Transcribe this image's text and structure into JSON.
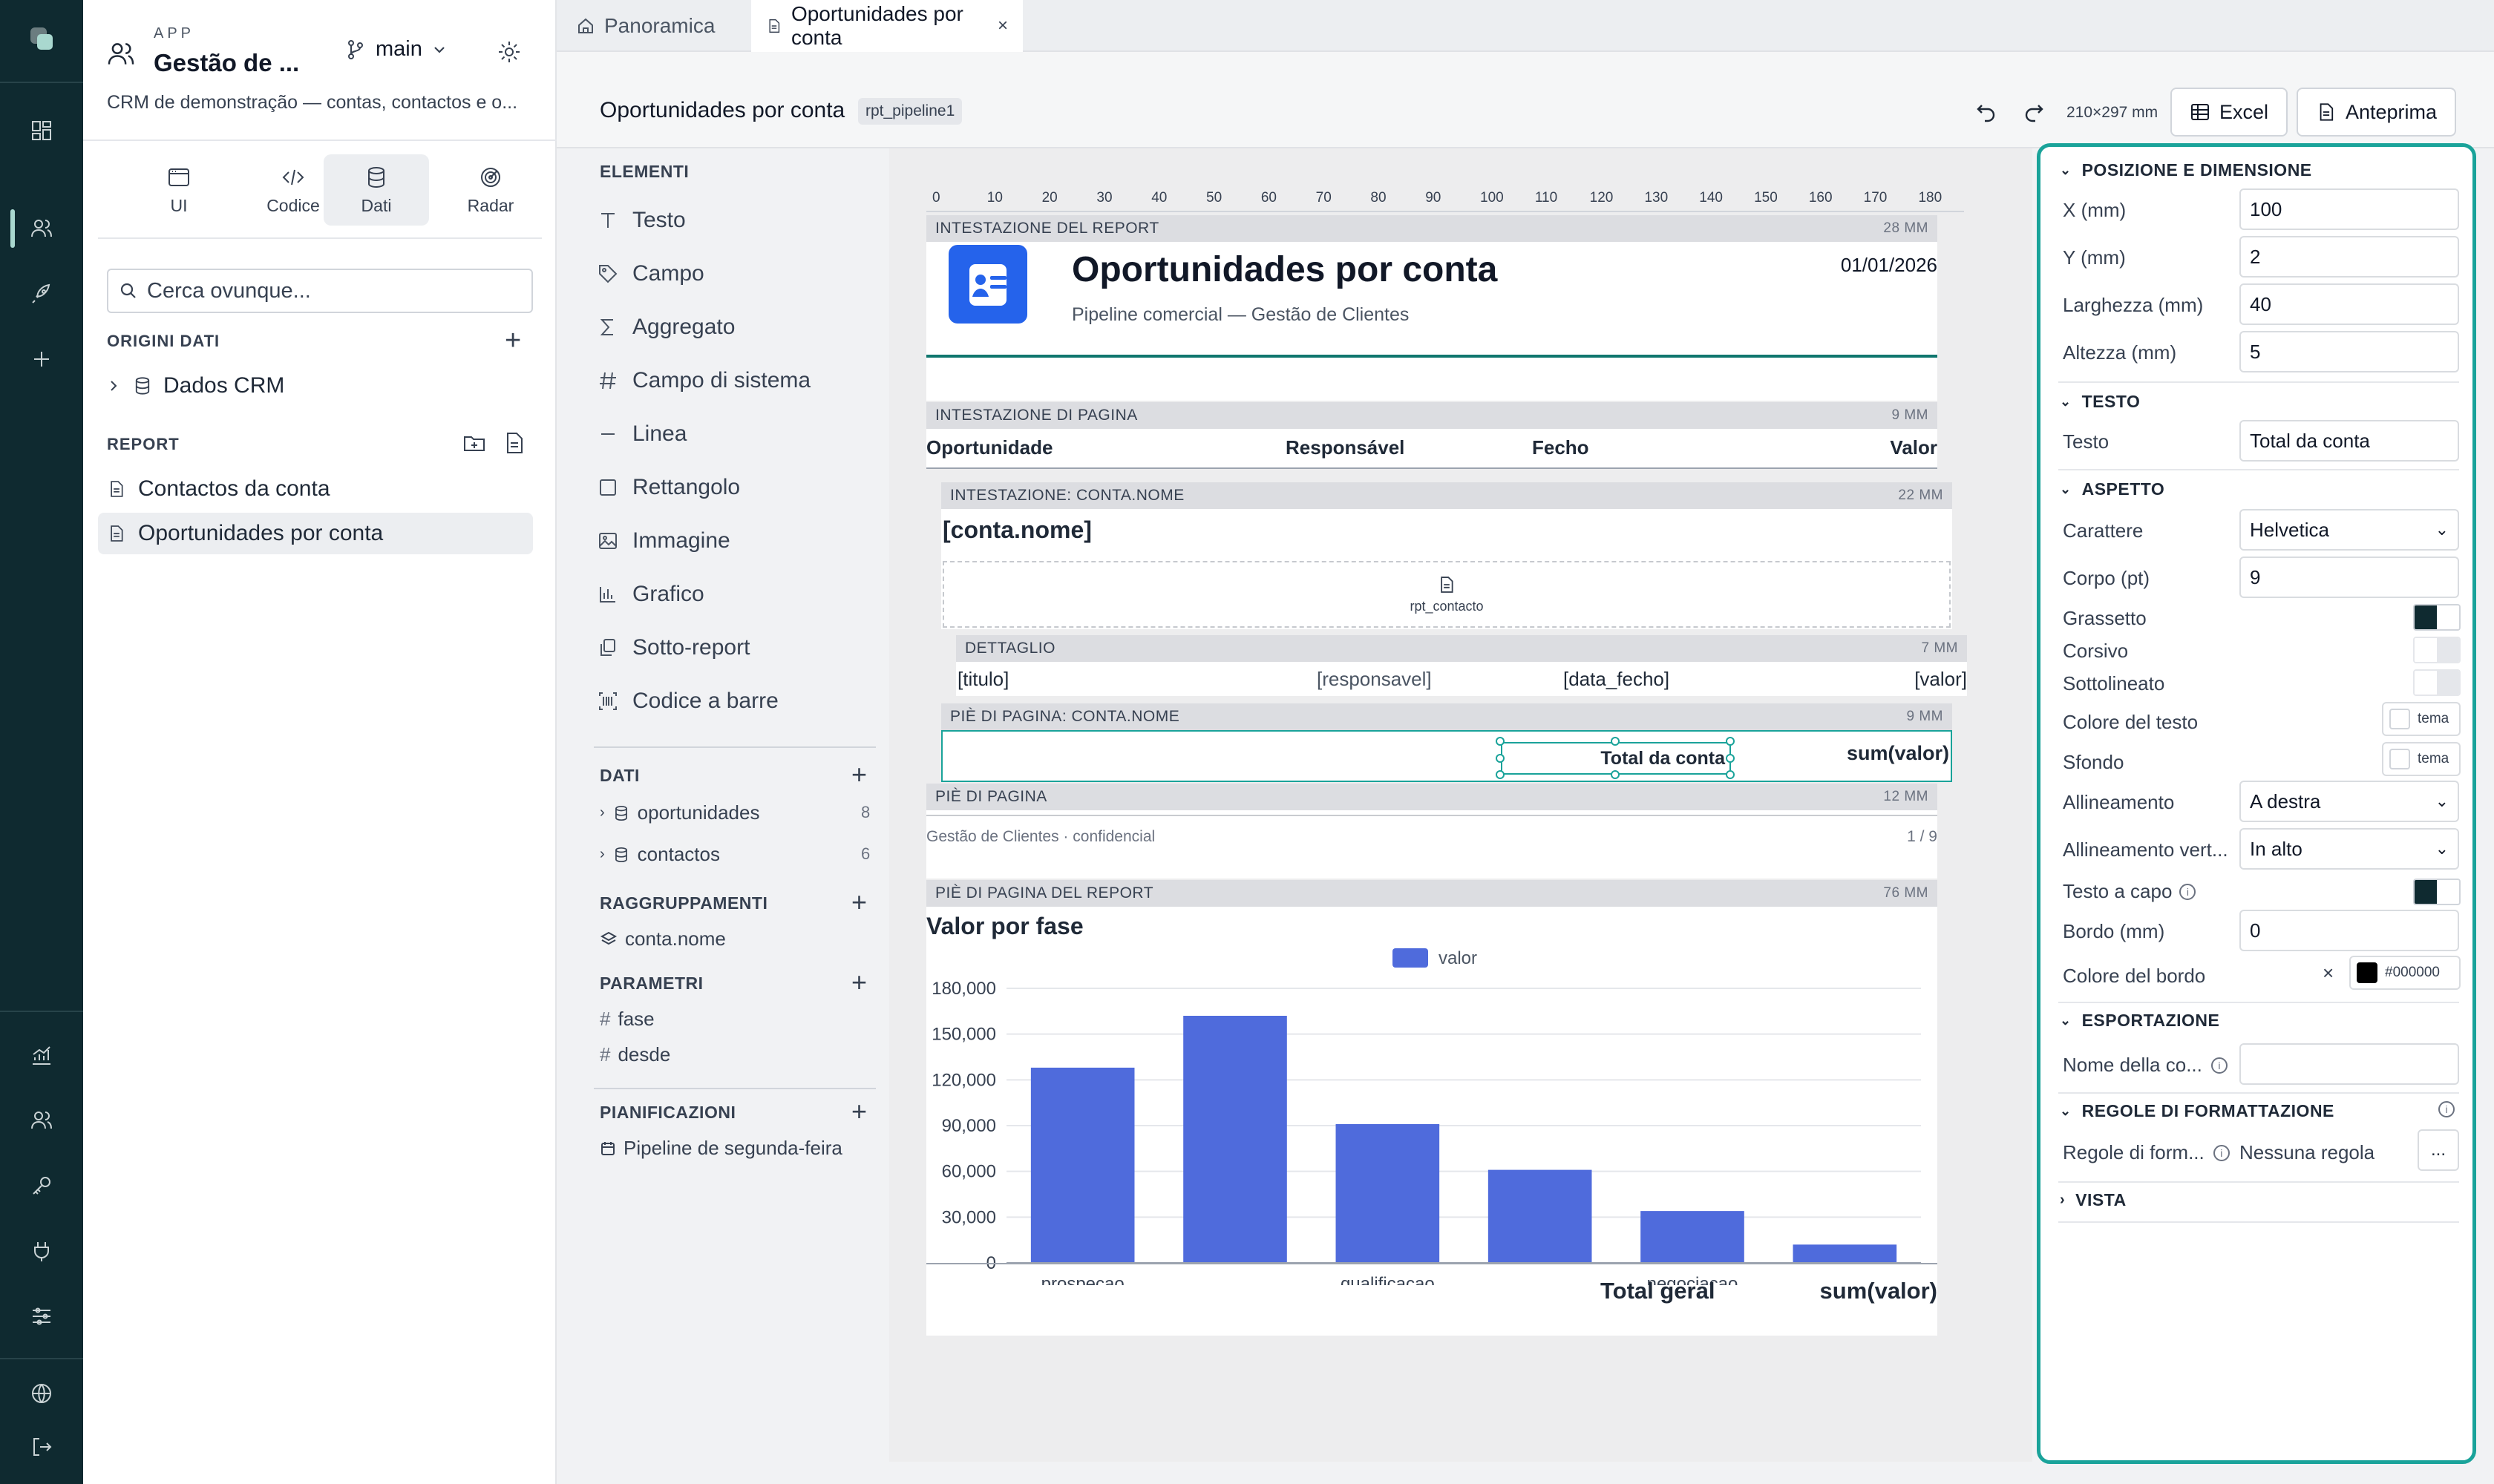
{
  "sidebar": {
    "app_caption": "APP",
    "app_name": "Gestão de ...",
    "branch": "main",
    "description": "CRM de demonstração — contas, contactos e o...",
    "nav_tabs": [
      {
        "label": "UI"
      },
      {
        "label": "Codice"
      },
      {
        "label": "Dati"
      },
      {
        "label": "Radar"
      }
    ],
    "search_placeholder": "Cerca ovunque...",
    "data_sources_header": "ORIGINI DATI",
    "data_source": "Dados CRM",
    "reports_header": "REPORT",
    "reports": [
      "Contactos da conta",
      "Oportunidades por conta"
    ]
  },
  "tabs": [
    {
      "label": "Panoramica"
    },
    {
      "label": "Oportunidades por conta"
    }
  ],
  "header": {
    "title": "Oportunidades por conta",
    "badge": "rpt_pipeline1",
    "page_size": "210×297 mm",
    "excel_label": "Excel",
    "preview_label": "Anteprima"
  },
  "palette": {
    "header": "ELEMENTI",
    "items": [
      "Testo",
      "Campo",
      "Aggregato",
      "Campo di sistema",
      "Linea",
      "Rettangolo",
      "Immagine",
      "Grafico",
      "Sotto-report",
      "Codice a barre"
    ],
    "dati_header": "DATI",
    "dati": [
      {
        "name": "oportunidades",
        "count": "8"
      },
      {
        "name": "contactos",
        "count": "6"
      }
    ],
    "groups_header": "RAGGRUPPAMENTI",
    "groups": [
      "conta.nome"
    ],
    "params_header": "PARAMETRI",
    "params": [
      "fase",
      "desde"
    ],
    "schedules_header": "PIANIFICAZIONI",
    "schedules": [
      "Pipeline de segunda-feira"
    ]
  },
  "ruler": [
    "0",
    "10",
    "20",
    "30",
    "40",
    "50",
    "60",
    "70",
    "80",
    "90",
    "100",
    "110",
    "120",
    "130",
    "140",
    "150",
    "160",
    "170",
    "180"
  ],
  "report": {
    "report_header": {
      "label": "INTESTAZIONE DEL REPORT",
      "mm": "28 MM",
      "title": "Oportunidades por conta",
      "subtitle": "Pipeline comercial — Gestão de Clientes",
      "date": "01/01/2026"
    },
    "page_header": {
      "label": "INTESTAZIONE DI PAGINA",
      "mm": "9 MM",
      "cols": [
        "Oportunidade",
        "Responsável",
        "Fecho",
        "Valor"
      ]
    },
    "group_header": {
      "label": "INTESTAZIONE: CONTA.NOME",
      "mm": "22 MM",
      "field": "[conta.nome]",
      "subreport": "rpt_contacto"
    },
    "detail": {
      "label": "DETTAGLIO",
      "mm": "7 MM",
      "fields": [
        "[titulo]",
        "[responsavel]",
        "[data_fecho]",
        "[valor]"
      ]
    },
    "group_footer": {
      "label": "PIÈ DI PAGINA: CONTA.NOME",
      "mm": "9 MM",
      "total_label": "Total da conta",
      "total_value": "sum(valor)"
    },
    "page_footer": {
      "label": "PIÈ DI PAGINA",
      "mm": "12 MM",
      "left": "Gestão de Clientes · confidencial",
      "right": "1 / 9"
    },
    "report_footer": {
      "label": "PIÈ DI PAGINA DEL REPORT",
      "mm": "76 MM",
      "grand_label": "Total geral",
      "grand_value": "sum(valor)"
    }
  },
  "chart_data": {
    "type": "bar",
    "title": "Valor por fase",
    "categories": [
      "prospecao",
      "",
      "qualificacao",
      "",
      "negociacao",
      ""
    ],
    "series": [
      {
        "name": "valor",
        "values": [
          128000,
          162000,
          91000,
          61000,
          34000,
          12000
        ],
        "color": "#4f6bdc"
      }
    ],
    "yticks": [
      "0",
      "30,000",
      "60,000",
      "90,000",
      "120,000",
      "150,000",
      "180,000"
    ],
    "ylim": [
      0,
      180000
    ],
    "legend": "top-center",
    "grid": true
  },
  "properties": {
    "pos_header": "POSIZIONE E DIMENSIONE",
    "x_label": "X (mm)",
    "x_value": "100",
    "y_label": "Y (mm)",
    "y_value": "2",
    "w_label": "Larghezza (mm)",
    "w_value": "40",
    "h_label": "Altezza (mm)",
    "h_value": "5",
    "text_header": "TESTO",
    "text_label": "Testo",
    "text_value": "Total da conta",
    "look_header": "ASPETTO",
    "font_label": "Carattere",
    "font_value": "Helvetica",
    "size_label": "Corpo (pt)",
    "size_value": "9",
    "bold_label": "Grassetto",
    "italic_label": "Corsivo",
    "underline_label": "Sottolineato",
    "color_label": "Colore del testo",
    "color_value": "tema",
    "bg_label": "Sfondo",
    "bg_value": "tema",
    "align_label": "Allineamento",
    "align_value": "A destra",
    "valign_label": "Allineamento vert...",
    "valign_value": "In alto",
    "wrap_label": "Testo a capo",
    "border_label": "Bordo (mm)",
    "border_value": "0",
    "bcolor_label": "Colore del bordo",
    "bcolor_value": "#000000",
    "export_header": "ESPORTAZIONE",
    "colname_label": "Nome della co...",
    "rules_header": "REGOLE DI FORMATTAZIONE",
    "rules_label": "Regole di form...",
    "rules_value": "Nessuna regola",
    "rules_btn": "...",
    "view_header": "VISTA"
  }
}
